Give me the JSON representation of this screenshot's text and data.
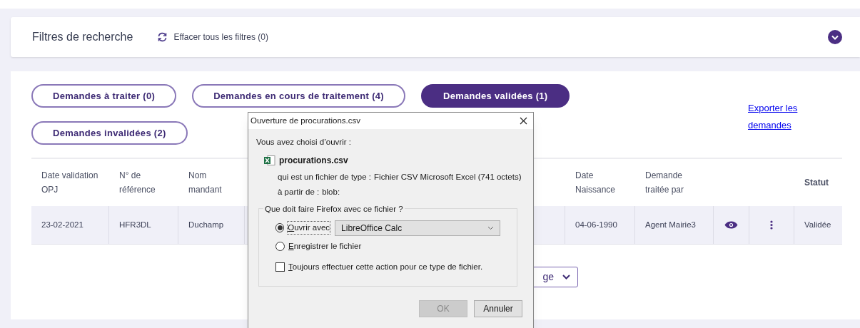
{
  "filters": {
    "title": "Filtres de recherche",
    "clear_label": "Effacer tous les filtres (0)",
    "expanded": false
  },
  "tabs": [
    {
      "label": "Demandes à traiter (0)",
      "selected": false
    },
    {
      "label": "Demandes en cours de traitement (4)",
      "selected": false
    },
    {
      "label": "Demandes validées (1)",
      "selected": true
    },
    {
      "label": "Demandes invalidées (2)",
      "selected": false
    }
  ],
  "export_link": "Exporter les demandes",
  "table": {
    "columns": [
      "Date validation\nOPJ",
      "N° de\nréférence",
      "Nom\nmandant",
      "Date\nNaissance",
      "Demande\ntraitée par",
      "Statut"
    ],
    "rows": [
      {
        "values": [
          "23-02-2021",
          "HFR3DL",
          "Duchamp",
          "04-06-1990",
          "Agent Mairie3",
          "Validée"
        ]
      }
    ]
  },
  "pagination_select": {
    "value": "ge"
  },
  "dialog": {
    "title": "Ouverture de procurations.csv",
    "intro": "Vous avez choisi d’ouvrir :",
    "filename": "procurations.csv",
    "type_label": "qui est un fichier de type :",
    "type_value": "Fichier CSV Microsoft Excel (741 octets)",
    "from_label": "à partir de :",
    "from_value": "blob:",
    "group_title": "Que doit faire Firefox avec ce fichier ?",
    "options": [
      {
        "label": "Ouvrir avec",
        "selected": true,
        "kind": "open"
      },
      {
        "label": "Enregistrer le fichier",
        "selected": false,
        "kind": "save"
      }
    ],
    "app": "LibreOffice Calc",
    "always": {
      "label": "Toujours effectuer cette action pour ce type de fichier.",
      "checked": false
    },
    "buttons": [
      {
        "label": "OK",
        "disabled": true
      },
      {
        "label": "Annuler",
        "disabled": false
      }
    ]
  }
}
